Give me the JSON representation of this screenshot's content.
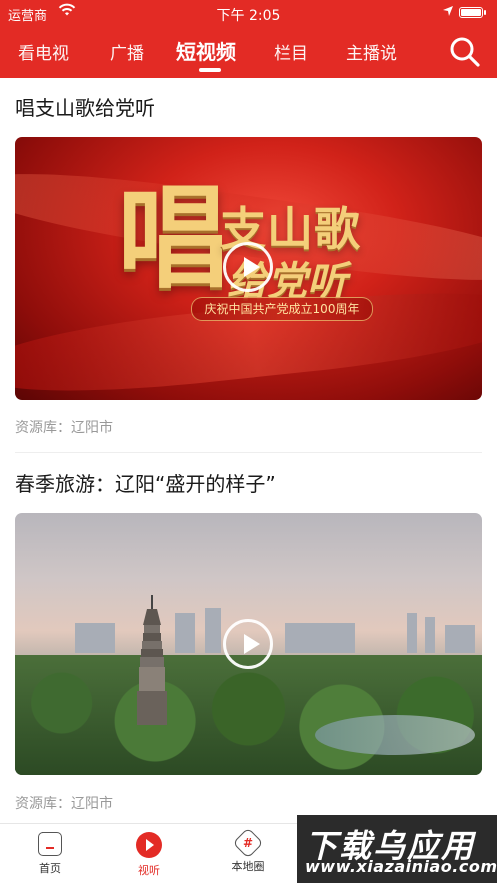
{
  "status_bar": {
    "carrier": "运营商",
    "time": "下午 2:05"
  },
  "tabs": [
    {
      "label": "看电视"
    },
    {
      "label": "广播"
    },
    {
      "label": "短视频",
      "active": true
    },
    {
      "label": "栏目"
    },
    {
      "label": "主播说"
    }
  ],
  "colors": {
    "brand_red": "#e32b25"
  },
  "icons": {
    "search": "search-icon",
    "wifi": "wifi-icon",
    "location": "location-arrow-icon",
    "battery": "battery-icon"
  },
  "videos": [
    {
      "title": "唱支山歌给党听",
      "thumb_text_big": "唱",
      "thumb_text_line1": "支山歌",
      "thumb_text_line2": "给党听",
      "thumb_banner": "庆祝中国共产党成立100周年",
      "source": "资源库：辽阳市"
    },
    {
      "title": "春季旅游：辽阳“盛开的样子”",
      "source": "资源库：辽阳市"
    }
  ],
  "bottom_nav": [
    {
      "label": "首页",
      "icon": "home-icon"
    },
    {
      "label": "视听",
      "icon": "play-circle-icon",
      "active": true
    },
    {
      "label": "本地圈",
      "icon": "hashtag-icon"
    }
  ],
  "watermark": {
    "line1": "下载乌应用",
    "line2": "www.xiazainiao.com"
  }
}
